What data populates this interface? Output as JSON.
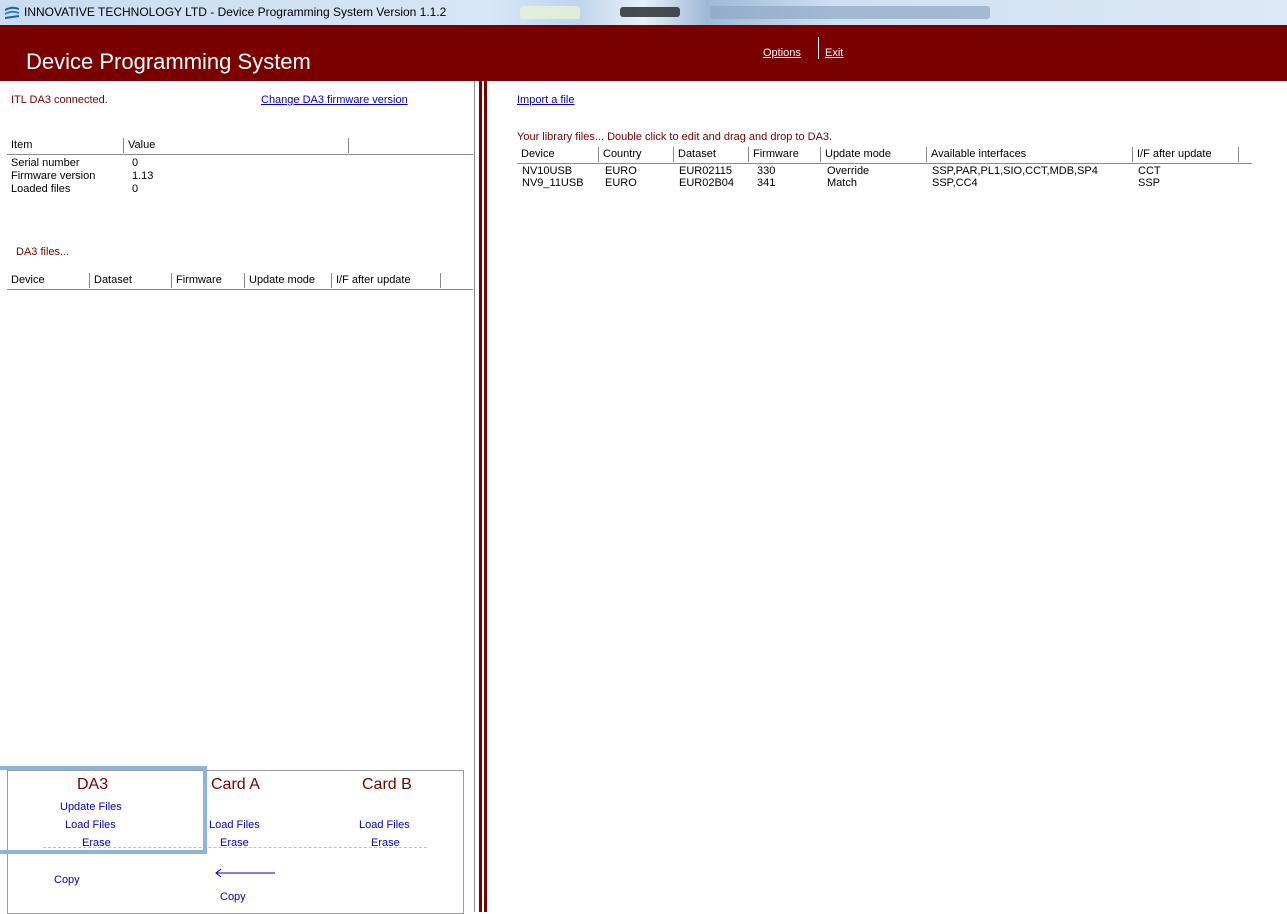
{
  "window": {
    "title": "INNOVATIVE TECHNOLOGY LTD  -  Device Programming System  Version 1.1.2"
  },
  "header": {
    "app_title": "Device Programming System",
    "options": "Options",
    "exit": "Exit",
    "bg_color": "#7a0000"
  },
  "left": {
    "status": "ITL DA3 connected.",
    "change_firmware": "Change DA3 firmware version",
    "info_columns": [
      "Item",
      "Value"
    ],
    "info_rows": [
      {
        "item": "Serial number",
        "value": "0"
      },
      {
        "item": "Firmware version",
        "value": "1.13"
      },
      {
        "item": "Loaded files",
        "value": "0"
      }
    ],
    "da3_files_label": "DA3 files...",
    "da3_columns": [
      "Device",
      "Dataset",
      "Firmware",
      "Update mode",
      "I/F after update"
    ]
  },
  "bottom": {
    "da3": {
      "title": "DA3",
      "update": "Update Files",
      "load": "Load Files",
      "erase": "Erase"
    },
    "card_a": {
      "title": "Card A",
      "load": "Load Files",
      "erase": "Erase"
    },
    "card_b": {
      "title": "Card B",
      "load": "Load Files",
      "erase": "Erase"
    },
    "copy_left": "Copy",
    "copy_arrow": "Copy"
  },
  "right": {
    "import": "Import a file",
    "library_label": "Your library files...  Double click to edit and drag and drop to DA3.",
    "columns": [
      "Device",
      "Country",
      "Dataset",
      "Firmware",
      "Update mode",
      "Available interfaces",
      "I/F after update"
    ],
    "rows": [
      [
        "NV10USB",
        "EURO",
        "EUR02115",
        "330",
        "Override",
        "SSP,PAR,PL1,SIO,CCT,MDB,SP4",
        "CCT"
      ],
      [
        "NV9_11USB",
        "EURO",
        "EUR02B04",
        "341",
        "Match",
        "SSP,CC4",
        "SSP"
      ]
    ]
  }
}
